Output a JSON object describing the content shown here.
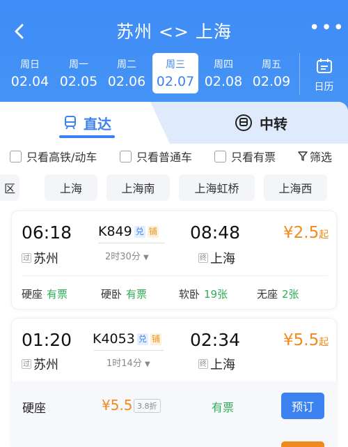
{
  "header": {
    "title": "苏州 <> 上海",
    "back_icon": "chevron-left-icon",
    "more_label": "•••"
  },
  "dates": [
    {
      "weekday": "周日",
      "date": "02.04"
    },
    {
      "weekday": "周一",
      "date": "02.05"
    },
    {
      "weekday": "周二",
      "date": "02.06"
    },
    {
      "weekday": "周三",
      "date": "02.07",
      "active": true
    },
    {
      "weekday": "周四",
      "date": "02.08"
    },
    {
      "weekday": "周五",
      "date": "02.09"
    }
  ],
  "calendar": {
    "label": "日历",
    "icon": "calendar-icon"
  },
  "tabs": {
    "direct": "直达",
    "transfer": "中转"
  },
  "filters": {
    "high_speed": "只看高铁/动车",
    "regular": "只看普通车",
    "available": "只看有票",
    "filter": "筛选"
  },
  "stations": [
    "区",
    "上海",
    "上海南",
    "上海虹桥",
    "上海西"
  ],
  "trains": [
    {
      "depart_time": "06:18",
      "arrive_time": "08:48",
      "train_no": "K849",
      "badge1": "兑",
      "badge2": "铺",
      "duration": "2时30分",
      "from_tag": "过",
      "from": "苏州",
      "to_tag": "终",
      "to": "上海",
      "price": "¥2.5",
      "price_suffix": "起",
      "seats": [
        {
          "name": "硬座",
          "status": "有票"
        },
        {
          "name": "硬卧",
          "status": "有票"
        },
        {
          "name": "软卧",
          "status": "19张"
        },
        {
          "name": "无座",
          "status": "2张"
        }
      ]
    },
    {
      "depart_time": "01:20",
      "arrive_time": "02:34",
      "train_no": "K4053",
      "badge1": "兑",
      "badge2": "铺",
      "duration": "1时14分",
      "from_tag": "过",
      "from": "苏州",
      "to_tag": "终",
      "to": "上海",
      "price": "¥5.5",
      "price_suffix": "起"
    }
  ],
  "expanded_seat": {
    "name": "硬座",
    "price": "¥5.5",
    "discount": "3.8折",
    "status": "有票",
    "book_label": "预订"
  },
  "colors": {
    "primary": "#3b82f0",
    "price": "#f08a1c",
    "available": "#2fae55"
  }
}
